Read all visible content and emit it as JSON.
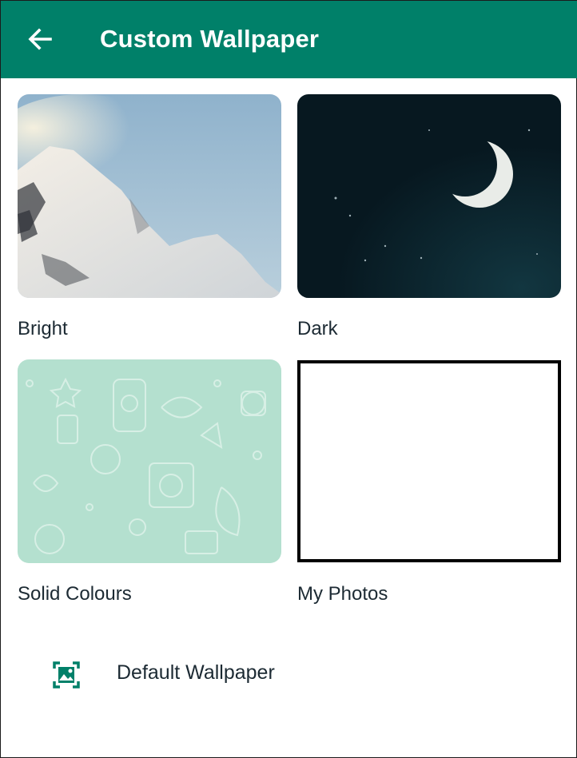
{
  "header": {
    "title": "Custom Wallpaper",
    "back_icon": "arrow-left-icon",
    "color": "#008069"
  },
  "categories": [
    {
      "label": "Bright"
    },
    {
      "label": "Dark"
    },
    {
      "label": "Solid Colours"
    },
    {
      "label": "My Photos"
    }
  ],
  "default_wallpaper": {
    "label": "Default Wallpaper",
    "icon": "image-frame-icon",
    "icon_color": "#008069"
  }
}
